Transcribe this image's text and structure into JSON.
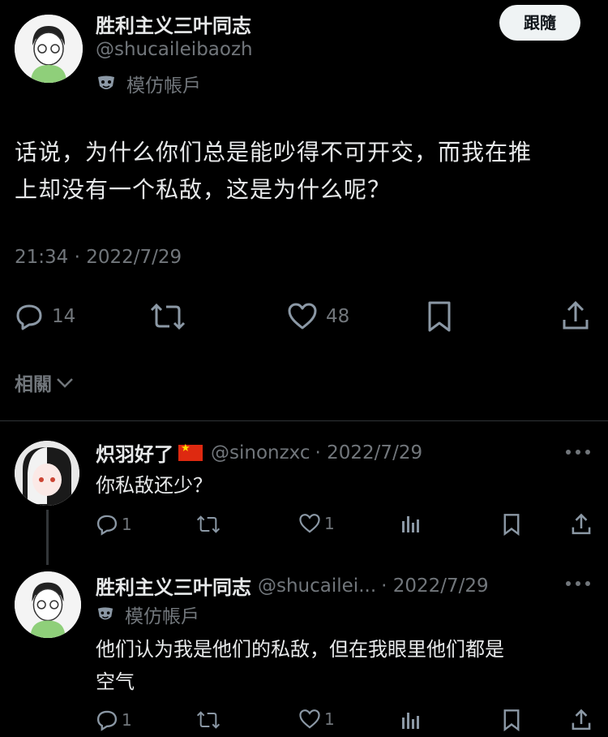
{
  "main_tweet": {
    "display_name": "胜利主义三叶同志",
    "handle": "@shucaileibaozh",
    "label": "模仿帳戶",
    "text_line1": "话说，为什么你们总是能吵得不可开交，而我在推",
    "text_line2": "上却没有一个私敌，这是为什么呢？",
    "timestamp": "21:34 · 2022/7/29",
    "follow_label": "跟隨",
    "replies_count": "14",
    "likes_count": "48"
  },
  "related_label": "相關",
  "reply1": {
    "display_name": "炽羽好了",
    "handle": "@sinonzxc",
    "date": "· 2022/7/29",
    "text": "你私敌还少？",
    "replies_count": "1",
    "likes_count": "1"
  },
  "reply2": {
    "display_name": "胜利主义三叶同志",
    "handle": "@shucailei...",
    "date": "· 2022/7/29",
    "label": "模仿帳戶",
    "text_line1": "他们认为我是他们的私敌，但在我眼里他们都是",
    "text_line2": "空气",
    "replies_count": "1",
    "likes_count": "1"
  }
}
